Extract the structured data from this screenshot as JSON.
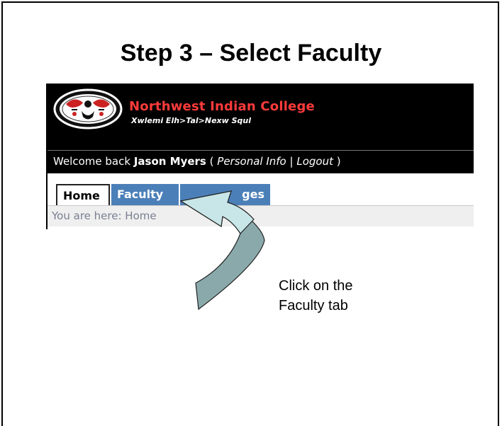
{
  "slide": {
    "title": "Step 3 – Select Faculty",
    "callout": "Click on the Faculty tab"
  },
  "header": {
    "college_name": "Northwest Indian College",
    "college_subtitle": "Xwlemi Elh>Tal>Nexw Squl"
  },
  "welcome": {
    "prefix": "Welcome back",
    "user_name": "Jason Myers",
    "open_paren": "(",
    "personal_info": "Personal Info",
    "separator": "|",
    "logout": "Logout",
    "close_paren": ")"
  },
  "tabs": [
    {
      "label": "Home",
      "active": true
    },
    {
      "label": "Faculty",
      "active": false
    },
    {
      "label": "ges",
      "active": false
    }
  ],
  "breadcrumb": {
    "prefix": "You are here:",
    "current": "Home"
  },
  "colors": {
    "tab_inactive": "#4b7fb8",
    "banner": "#000000",
    "college_name": "#ff3b3b",
    "arrow_light": "#c8e6e8",
    "arrow_dark": "#8aa9aa"
  },
  "icons": {
    "logo": "college-seal-logo",
    "pointer": "curved-pointer-arrow"
  }
}
